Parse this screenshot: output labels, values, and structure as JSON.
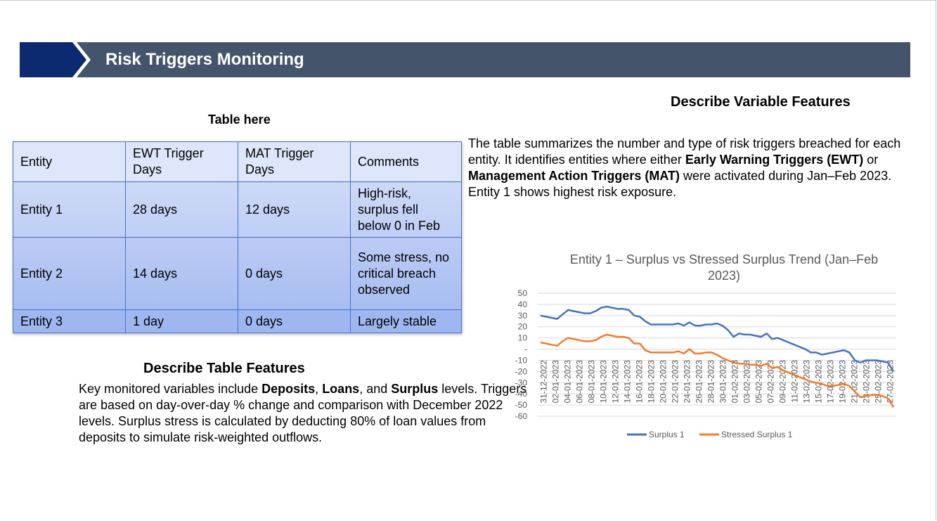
{
  "header": {
    "title": "Risk Triggers Monitoring"
  },
  "colors": {
    "banner_dark": "#0b2a6f",
    "banner_bar": "#44546a",
    "surplus": "#4472c4",
    "stressed": "#ed7d31",
    "table_border": "#4472c4"
  },
  "table": {
    "caption": "Table here",
    "headers": [
      "Entity",
      "EWT Trigger Days",
      "MAT Trigger Days",
      "Comments"
    ],
    "rows": [
      [
        "Entity 1",
        "28 days",
        "12 days",
        "High-risk, surplus fell below 0 in Feb"
      ],
      [
        "Entity 2",
        "14 days",
        "0 days",
        "Some stress, no critical breach observed"
      ],
      [
        "Entity 3",
        "1 day",
        "0 days",
        "Largely stable"
      ]
    ]
  },
  "variable_features": {
    "heading": "Describe Variable Features",
    "p1": "The table summarizes the number and type of risk triggers breached for each entity. It identifies entities where either ",
    "b1": "Early Warning Triggers (EWT)",
    "p2": " or ",
    "b2": "Management Action Triggers (MAT)",
    "p3": " were activated during Jan–Feb 2023. Entity 1 shows highest risk exposure."
  },
  "table_features": {
    "heading": "Describe Table Features",
    "p1": "Key monitored variables include ",
    "b1": "Deposits",
    "p2": ", ",
    "b2": "Loans",
    "p3": ", and ",
    "b3": "Surplus",
    "p4": " levels. Triggers are based on day-over-day % change and comparison with December 2022 levels. Surplus stress is calculated by deducting 80% of loan values from deposits to simulate risk-weighted outflows."
  },
  "chart_data": {
    "type": "line",
    "title": "Entity 1 – Surplus vs Stressed Surplus Trend (Jan–Feb 2023)",
    "ylim": [
      -60,
      50
    ],
    "yticks": [
      50,
      40,
      30,
      20,
      10,
      0,
      -10,
      -20,
      -30,
      -40,
      -50,
      -60
    ],
    "ytick_labels": [
      "50",
      "40",
      "30",
      "20",
      "10",
      "-",
      "-10",
      "-20",
      "-30",
      "-40",
      "-50",
      "-60"
    ],
    "grid": true,
    "legend_position": "bottom",
    "x_labels": [
      "31-12-2022",
      "02-01-2023",
      "04-01-2023",
      "06-01-2023",
      "08-01-2023",
      "10-01-2023",
      "12-01-2023",
      "14-01-2023",
      "16-01-2023",
      "18-01-2023",
      "20-01-2023",
      "22-01-2023",
      "24-01-2023",
      "26-01-2023",
      "28-01-2023",
      "30-01-2023",
      "01-02-2023",
      "03-02-2023",
      "05-02-2023",
      "07-02-2023",
      "09-02-2023",
      "11-02-2023",
      "13-02-2023",
      "15-02-2023",
      "17-02-2023",
      "19-02-2023",
      "21-02-2023",
      "23-02-2023",
      "25-02-2023",
      "27-02-2023"
    ],
    "series": [
      {
        "name": "Surplus 1",
        "values": [
          30,
          29,
          28,
          27,
          31,
          35,
          34,
          33,
          32,
          32,
          34,
          37,
          38,
          37,
          36,
          36,
          35,
          30,
          29,
          25,
          22,
          22,
          22,
          22,
          22,
          23,
          21,
          24,
          21,
          21,
          22,
          22,
          23,
          21,
          17,
          11,
          14,
          13,
          13,
          12,
          11,
          14,
          9,
          10,
          8,
          6,
          4,
          2,
          0,
          -3,
          -3,
          -5,
          -4,
          -3,
          -2,
          -1,
          -3,
          -10,
          -12,
          -10,
          -10,
          -10,
          -11,
          -12,
          -20
        ]
      },
      {
        "name": "Stressed Surplus 1",
        "values": [
          6,
          5,
          4,
          3,
          7,
          10,
          9,
          8,
          7,
          7,
          8,
          11,
          13,
          12,
          11,
          11,
          10,
          5,
          5,
          -1,
          -3,
          -3,
          -3,
          -3,
          -3,
          -2,
          -4,
          0,
          -4,
          -4,
          -3,
          -3,
          -5,
          -8,
          -10,
          -12,
          -13,
          -13,
          -14,
          -14,
          -15,
          -13,
          -17,
          -16,
          -19,
          -21,
          -23,
          -25,
          -27,
          -29,
          -30,
          -31,
          -33,
          -33,
          -32,
          -31,
          -33,
          -38,
          -43,
          -42,
          -41,
          -41,
          -42,
          -44,
          -52
        ]
      }
    ]
  }
}
